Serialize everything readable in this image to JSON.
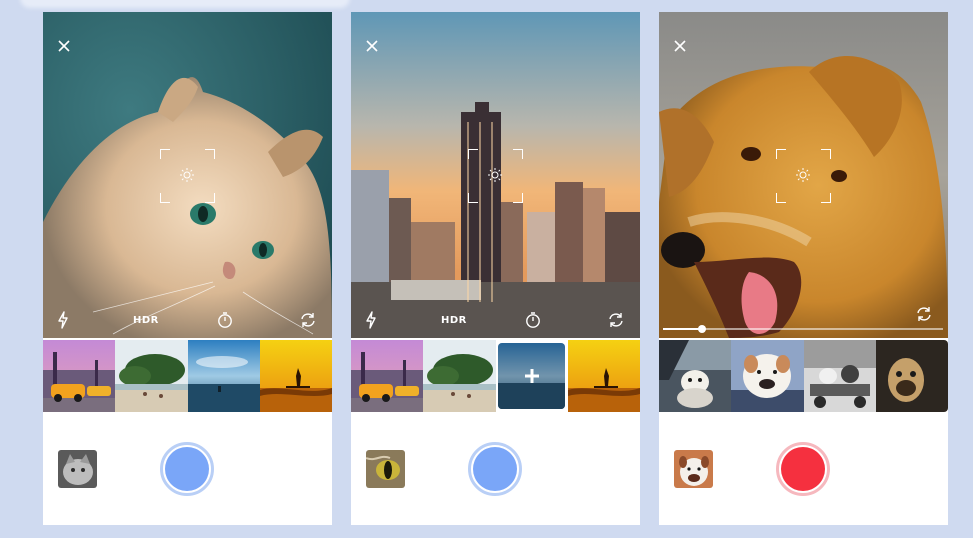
{
  "screens": [
    {
      "name": "cat-screen",
      "controls": {
        "hdr_label": "HDR"
      },
      "shutter": {
        "state": "ready",
        "color": "#7aa6f8",
        "ring_color": "#b9cff6"
      },
      "gallery_thumb_icon": "cat-photo",
      "thumbnails": [
        "city-street-car",
        "beach-trees",
        "ocean-horizon",
        "surfer-sunset"
      ]
    },
    {
      "name": "city-screen",
      "controls": {
        "hdr_label": "HDR"
      },
      "shutter": {
        "state": "ready",
        "color": "#7aa6f8",
        "ring_color": "#b9cff6"
      },
      "gallery_thumb_icon": "cat-eye-photo",
      "thumbnails": [
        "city-street-car",
        "beach-trees",
        "ocean-horizon-selected",
        "surfer-sunset"
      ],
      "selected_thumbnail": 2
    },
    {
      "name": "dog-screen",
      "controls": {},
      "shutter": {
        "state": "recording",
        "color": "#f5303f",
        "ring_color": "#f6b8be"
      },
      "gallery_thumb_icon": "bulldog-photo",
      "thumbnails": [
        "dog-in-car",
        "bulldog",
        "dogs-on-cart",
        "pug-portrait"
      ],
      "progress": 0.14
    }
  ],
  "colors": {
    "background": "#cfdaf0",
    "accent_blue": "#7aa6f8",
    "record_red": "#f5303f"
  }
}
